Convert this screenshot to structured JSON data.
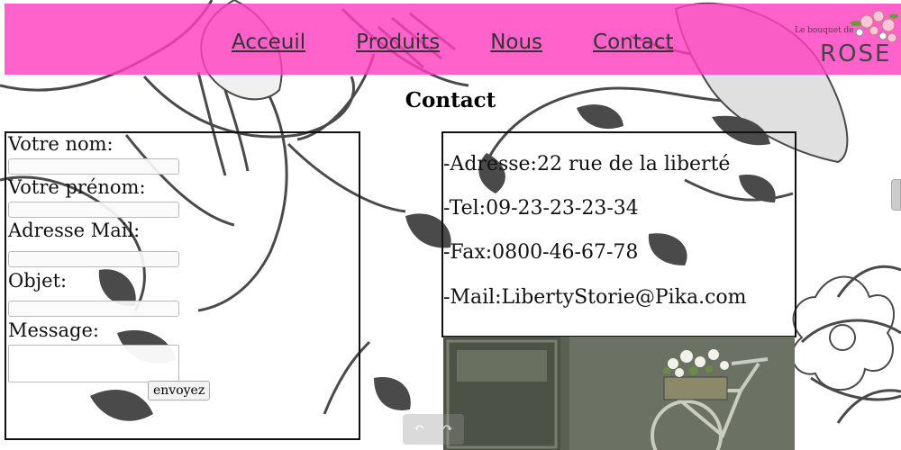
{
  "nav": {
    "items": [
      {
        "label": "Acceuil"
      },
      {
        "label": "Produits"
      },
      {
        "label": "Nous"
      },
      {
        "label": "Contact"
      }
    ],
    "logo_small": "Le bouquet de",
    "logo_big": "ROSE"
  },
  "page": {
    "title": "Contact"
  },
  "form": {
    "nom_label": "Votre nom:",
    "prenom_label": "Votre prénom:",
    "mail_label": "Adresse Mail:",
    "objet_label": "Objet:",
    "message_label": "Message:",
    "submit_label": "envoyez"
  },
  "info": {
    "address": "-Adresse:22 rue de la liberté",
    "tel": "-Tel:09-23-23-23-34",
    "fax": "-Fax:0800-46-67-78",
    "mail": "-Mail:LibertyStorie@Pika.com"
  },
  "colors": {
    "navbar": "#ff40be",
    "outline": "#111111",
    "floral": "#4a4a4a"
  },
  "icons": [
    "rose-bouquet-logo",
    "bicycle-photo",
    "undo-arrow-icon",
    "redo-arrow-icon"
  ]
}
